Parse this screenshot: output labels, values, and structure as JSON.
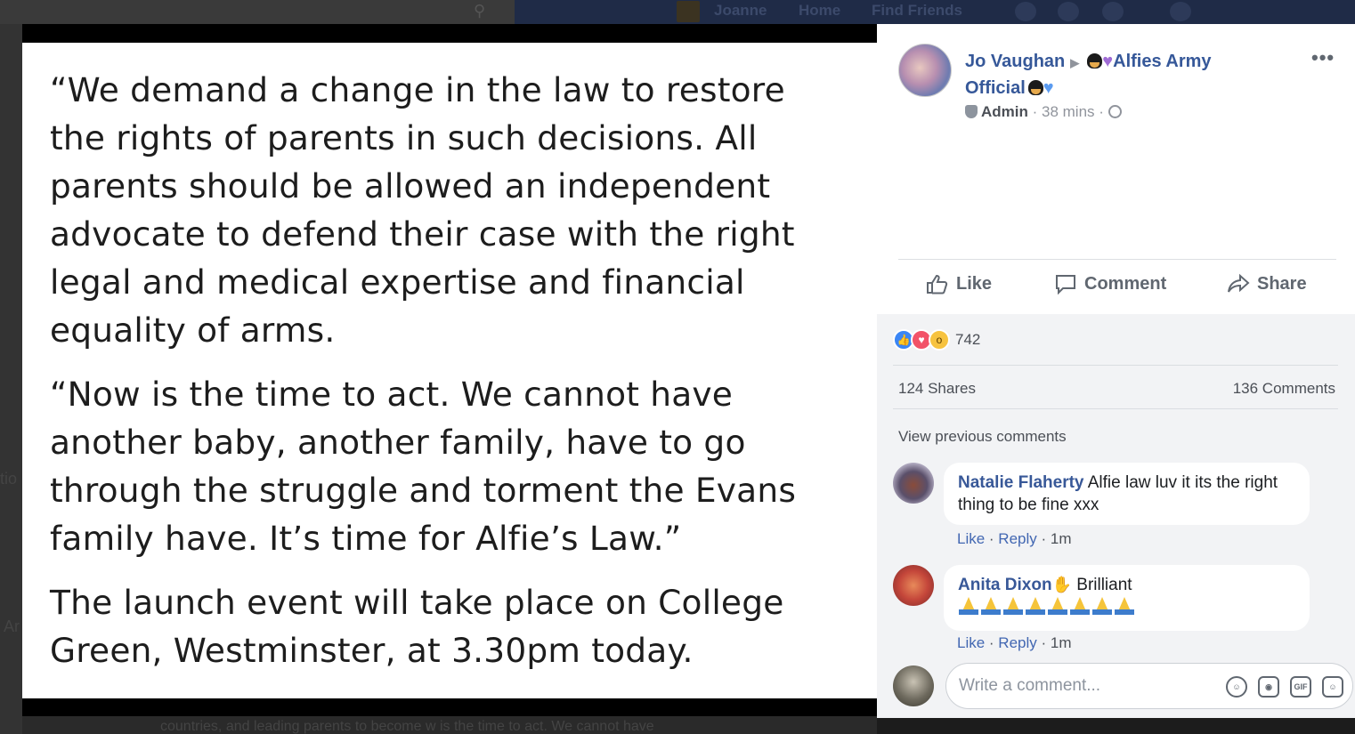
{
  "background": {
    "nav_user": "Joanne",
    "nav_home": "Home",
    "nav_find_friends": "Find Friends",
    "bottom_text": "countries, and leading parents to become   w is the time to act. We cannot have"
  },
  "photo": {
    "paragraphs": [
      "“We demand a change in the law to restore the rights of parents in such decisions. All parents should be allowed an independent advocate to defend their case with the right legal and medical expertise and financial equality of arms.",
      "“Now is the time to act. We cannot have another baby, another family, have to go through the struggle and torment the Evans family have. It’s time for Alfie’s Law.”",
      "The launch event will take place on College Green, Westminster, at 3.30pm today."
    ]
  },
  "post": {
    "author": "Jo Vaughan",
    "group": "Alfies Army Official",
    "role": "Admin",
    "time": "38 mins",
    "more": "•••"
  },
  "actions": {
    "like": "Like",
    "comment": "Comment",
    "share": "Share"
  },
  "stats": {
    "reactions_count": "742",
    "shares": "124 Shares",
    "comments": "136 Comments",
    "view_previous": "View previous comments"
  },
  "comments": [
    {
      "name": "Natalie Flaherty",
      "text": "Alfie law luv it its the right thing to be fine xxx",
      "like": "Like",
      "reply": "Reply",
      "time": "1m"
    },
    {
      "name": "Anita Dixon",
      "text": "Brilliant",
      "like": "Like",
      "reply": "Reply",
      "time": "1m"
    }
  ],
  "composer": {
    "placeholder": "Write a comment..."
  },
  "colors": {
    "link": "#365899",
    "accent": "#4267b2",
    "like_blue": "#3b86f5",
    "love_red": "#f25268",
    "wow_yellow": "#f7c33f"
  }
}
